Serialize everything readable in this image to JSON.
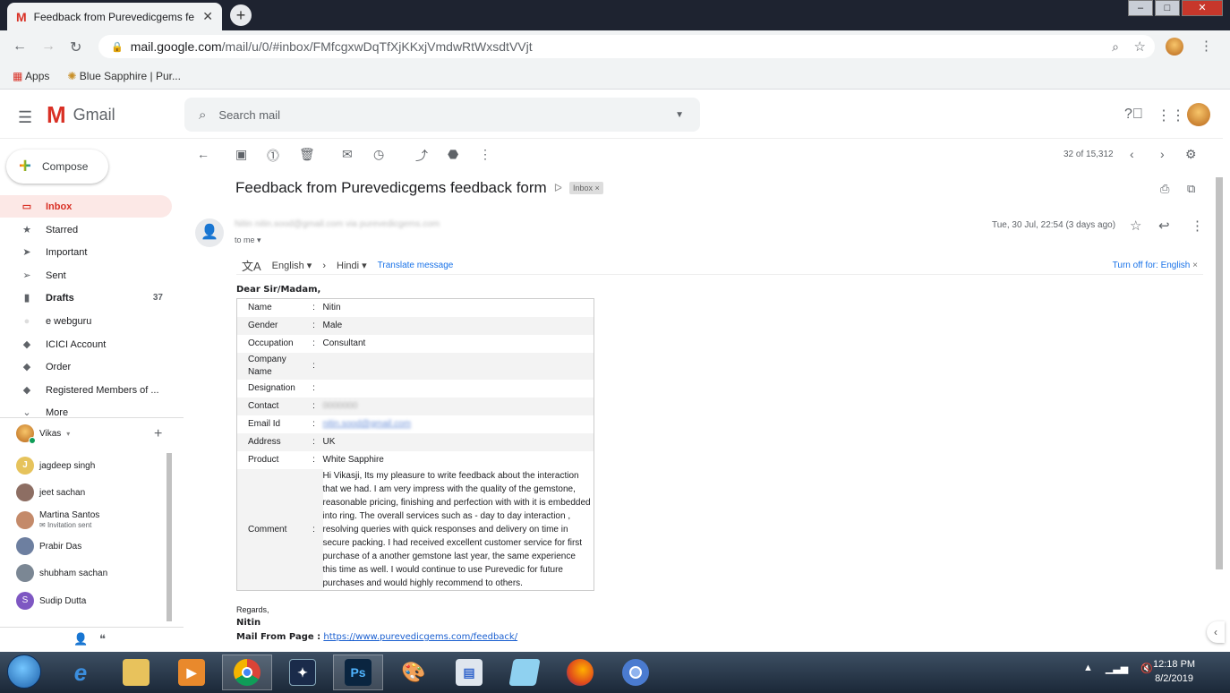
{
  "browser": {
    "tab_title": "Feedback from Purevedicgems fe",
    "tab_close": "✕",
    "new_tab": "+",
    "url_host": "mail.google.com",
    "url_path": "/mail/u/0/#inbox/FMfcgxwDqTfXjKKxjVmdwRtWxsdtVVjt",
    "bookmarks": [
      "Apps",
      "Blue Sapphire | Pur..."
    ]
  },
  "gmail": {
    "app_name": "Gmail",
    "search_placeholder": "Search mail",
    "compose_label": "Compose",
    "nav": [
      {
        "label": "Inbox",
        "icon": "inbox-icon",
        "count": ""
      },
      {
        "label": "Starred",
        "icon": "star-icon",
        "count": ""
      },
      {
        "label": "Important",
        "icon": "important-icon",
        "count": ""
      },
      {
        "label": "Sent",
        "icon": "send-icon",
        "count": ""
      },
      {
        "label": "Drafts",
        "icon": "draft-icon",
        "count": "37"
      },
      {
        "label": "e webguru",
        "icon": "label-icon",
        "count": ""
      },
      {
        "label": "ICICI Account",
        "icon": "label-icon",
        "count": ""
      },
      {
        "label": "Order",
        "icon": "label-icon",
        "count": ""
      },
      {
        "label": "Registered Members of ...",
        "icon": "label-icon",
        "count": ""
      },
      {
        "label": "More",
        "icon": "chevron-down-icon",
        "count": ""
      }
    ],
    "hangouts_user": "Vikas",
    "contacts": [
      {
        "name": "jagdeep singh",
        "sub": "",
        "initial": "J",
        "color": "#e6c35c"
      },
      {
        "name": "jeet sachan",
        "sub": "",
        "initial": "",
        "color": "#8d6e63"
      },
      {
        "name": "Martina Santos",
        "sub": "Invitation sent",
        "initial": "",
        "color": "#c48a6a"
      },
      {
        "name": "Prabir Das",
        "sub": "",
        "initial": "",
        "color": "#6d7fa0"
      },
      {
        "name": "shubham sachan",
        "sub": "",
        "initial": "",
        "color": "#7b8794"
      },
      {
        "name": "Sudip Dutta",
        "sub": "",
        "initial": "S",
        "color": "#7e57c2"
      }
    ],
    "page_info": "32 of 15,312"
  },
  "mail": {
    "subject": "Feedback from Purevedicgems feedback form",
    "label": "Inbox",
    "label_x": "×",
    "sender": "Nitin nitin.sood@gmail.com via purevedicgems.com",
    "to": "to me",
    "date": "Tue, 30 Jul, 22:54 (3 days ago)",
    "translate": {
      "from": "English",
      "to": "Hindi",
      "link": "Translate message",
      "turn_off": "Turn off for: English"
    },
    "greeting": "Dear Sir/Madam,",
    "fields": [
      {
        "key": "Name",
        "value": "Nitin"
      },
      {
        "key": "Gender",
        "value": "Male"
      },
      {
        "key": "Occupation",
        "value": "Consultant"
      },
      {
        "key": "Company Name",
        "value": ""
      },
      {
        "key": "Designation",
        "value": ""
      },
      {
        "key": "Contact",
        "value": "0000000"
      },
      {
        "key": "Email Id",
        "value": "nitin.sood@gmail.com"
      },
      {
        "key": "Address",
        "value": "UK"
      },
      {
        "key": "Product",
        "value": "White Sapphire"
      },
      {
        "key": "Comment",
        "value": "Hi Vikasji, Its my pleasure to write feedback about the interaction that we had. I am very impress with the quality of the gemstone, reasonable pricing, finishing and perfection with with it is embedded into ring. The overall services such as - day to day interaction , resolving queries with quick responses and delivery on time in secure packing. I had received excellent customer service for first purchase of a another gemstone last year, the same experience this time as well. I would continue to use Purevedic for future purchases and would highly recommend to others."
      }
    ],
    "colon": ":",
    "regards": "Regards,",
    "signature": "Nitin",
    "mail_from_label": "Mail From Page :",
    "mail_from_url": "https://www.purevedicgems.com/feedback/"
  },
  "taskbar": {
    "time": "12:18 PM",
    "date": "8/2/2019"
  }
}
